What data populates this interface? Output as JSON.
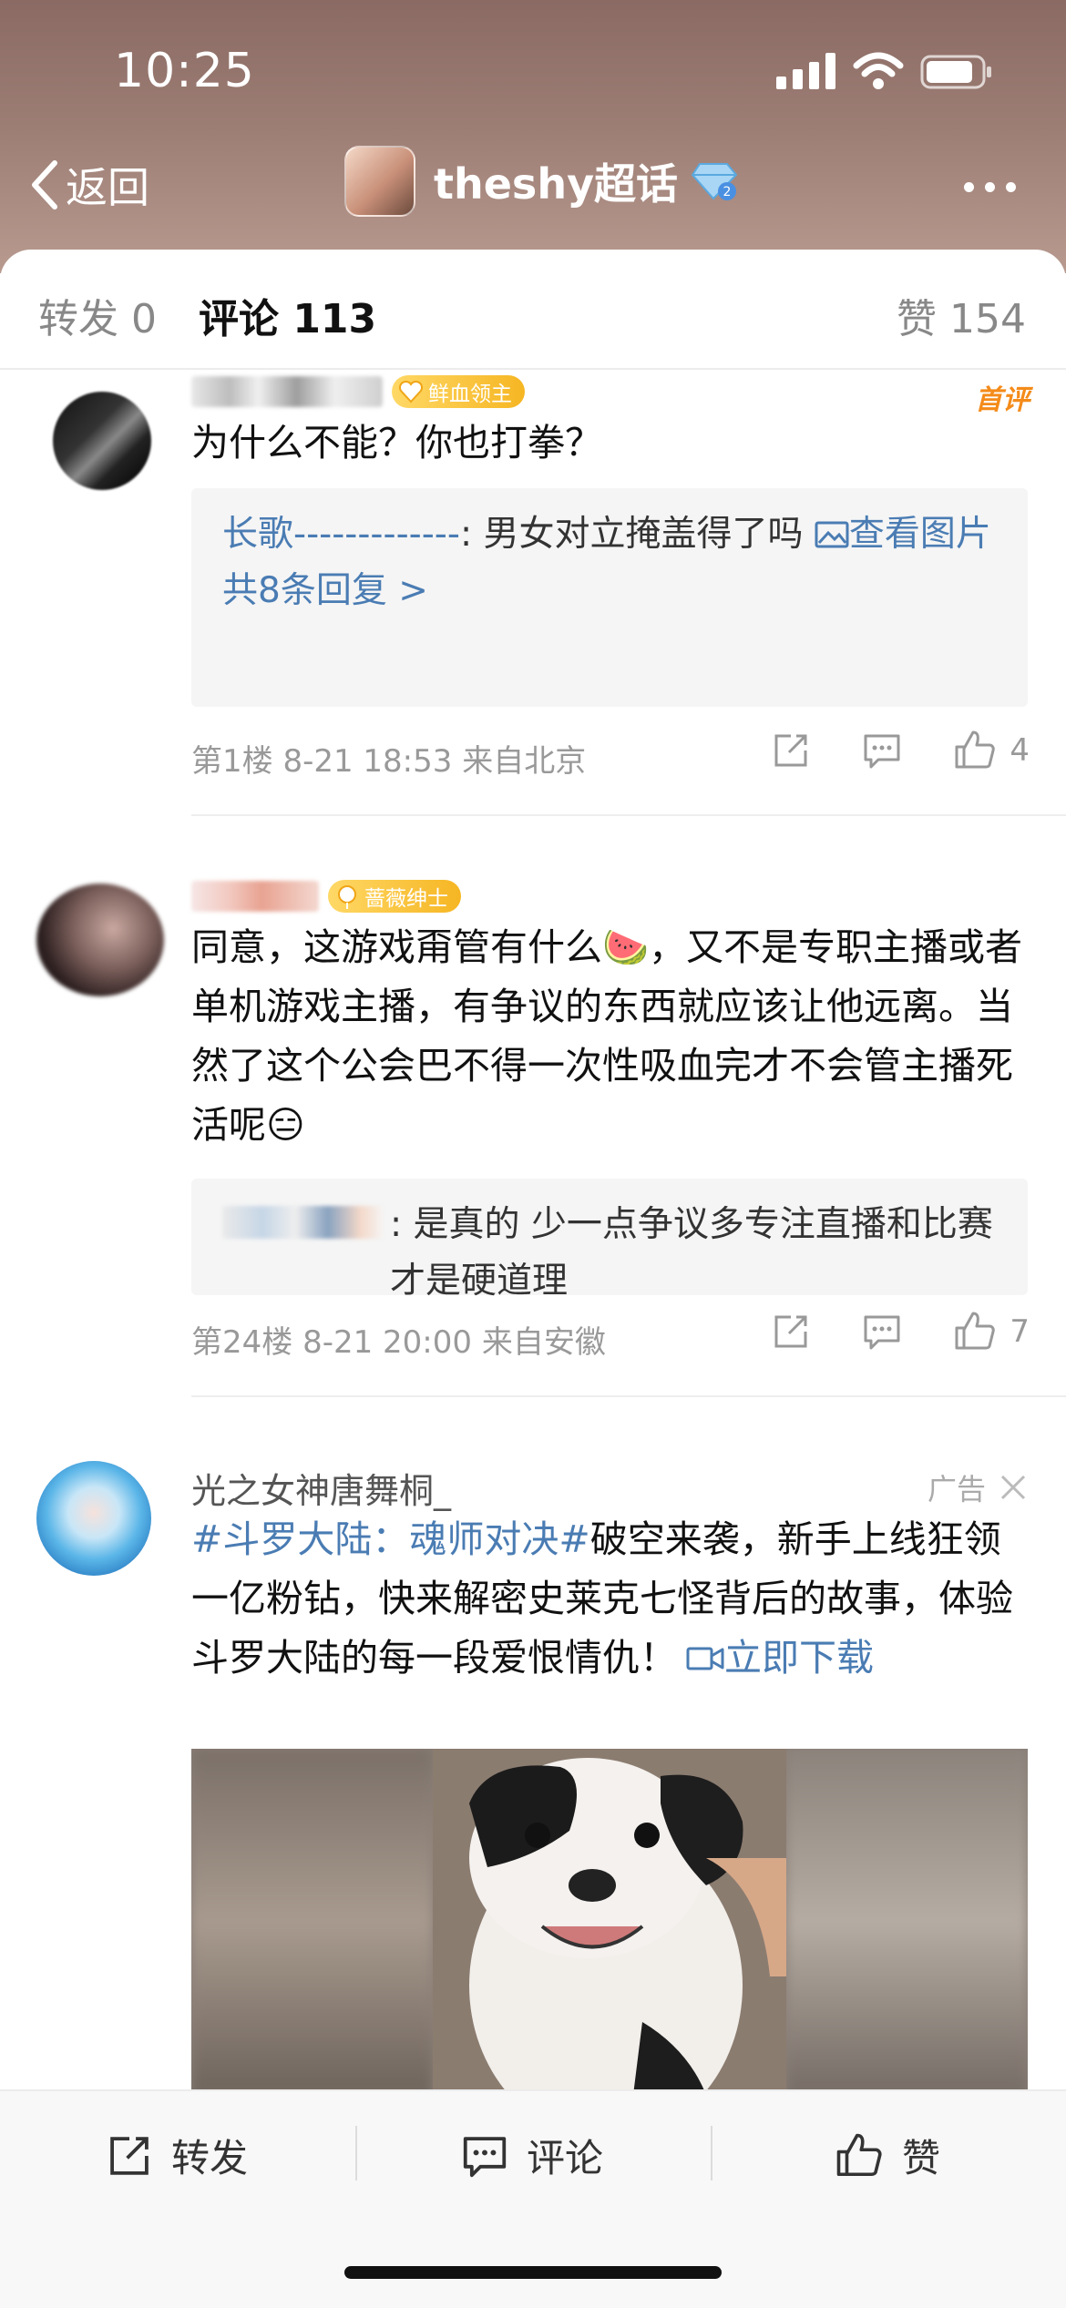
{
  "status_bar": {
    "time": "10:25"
  },
  "nav": {
    "back_label": "返回",
    "title": "theshy超话"
  },
  "tabs": {
    "repost": "转发 0",
    "comment": "评论 113",
    "like": "赞 154"
  },
  "comments": [
    {
      "badge": "鲜血领主",
      "first_label": "首评",
      "text": "为什么不能？你也打拳？",
      "reply": {
        "user": "长歌-------------",
        "text": ": 男女对立掩盖得了吗 ",
        "link_icon": "image-icon",
        "link": "查看图片",
        "count": "共8条回复 >"
      },
      "meta": "第1楼 8-21 18:53 来自北京",
      "likes": "4"
    },
    {
      "badge": "蔷薇绅士",
      "text": "同意，这游戏甭管有什么🍉，又不是专职主播或者单机游戏主播，有争议的东西就应该让他远离。当然了这个公会巴不得一次性吸血完才不会管主播死活呢😑",
      "reply": {
        "text": ": 是真的 少一点争议多专注直播和比赛 才是硬道理"
      },
      "meta": "第24楼 8-21 20:00 来自安徽",
      "likes": "7"
    }
  ],
  "ad": {
    "name": "光之女神唐舞桐_",
    "label": "广告",
    "topic": "#斗罗大陆：魂师对决#",
    "text": "破空来袭，新手上线狂领一亿粉钻，快来解密史莱克七怪背后的故事，体验斗罗大陆的每一段爱恨情仇！",
    "link_icon": "video-icon",
    "link": "立即下载"
  },
  "bottom_bar": {
    "repost": "转发",
    "comment": "评论",
    "like": "赞"
  },
  "colors": {
    "link": "#4a7cb3",
    "badge": "#f6b623",
    "first_label": "#f48b1a"
  }
}
